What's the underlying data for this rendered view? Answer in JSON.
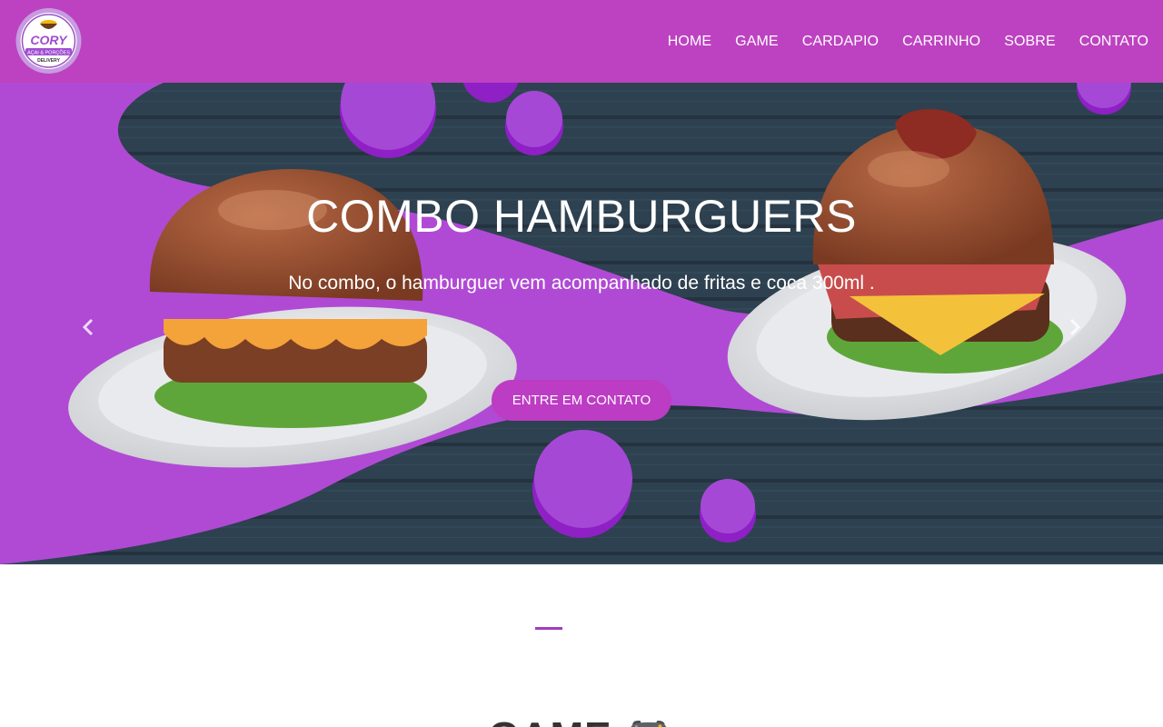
{
  "navbar": {
    "logo": {
      "name": "CORY",
      "tagline": "AÇAI & PORÇÕES",
      "sub": "DELIVERY"
    },
    "items": [
      {
        "label": "HOME"
      },
      {
        "label": "GAME"
      },
      {
        "label": "CARDAPIO"
      },
      {
        "label": "CARRINHO"
      },
      {
        "label": "SOBRE"
      },
      {
        "label": "CONTATO"
      }
    ]
  },
  "hero": {
    "title": "COMBO HAMBURGUERS",
    "subtitle": "No combo, o hamburguer vem acompanhado de fritas e coca 300ml .",
    "button": "ENTRE EM CONTATO",
    "prev_icon": "chevron-left-icon",
    "next_icon": "chevron-right-icon"
  },
  "section": {
    "title": "GAME 🎮"
  },
  "colors": {
    "brand": "#bd42c1",
    "button": "#bd3cc4",
    "wave": "#a93fd0",
    "wood": "#2c3e4b"
  }
}
